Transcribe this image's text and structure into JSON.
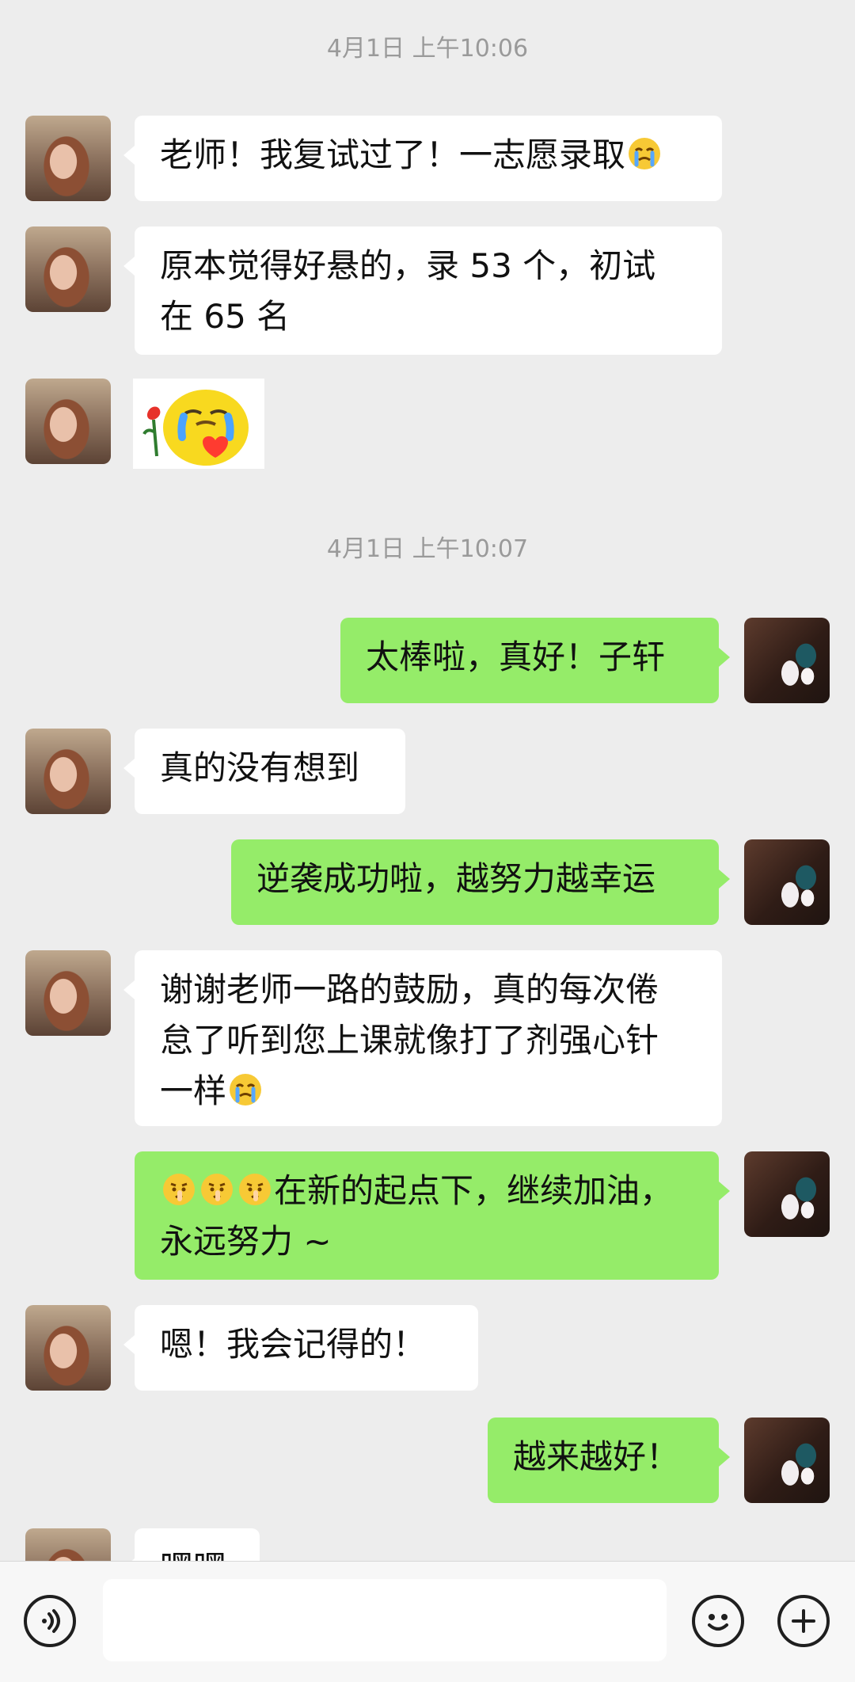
{
  "timestamps": [
    "4月1日 上午10:06",
    "4月1日 上午10:07"
  ],
  "messages": {
    "m1": {
      "text": "老师！我复试过了！一志愿录取",
      "emoji_after": "crying-face-emoji"
    },
    "m2": {
      "line1": "原本觉得好悬的，录 53 个，初试",
      "line2": "在 65 名"
    },
    "m3": {
      "sticker": "crying-duck-with-rose-and-heart-sticker"
    },
    "m4": {
      "text": "太棒啦，真好！子轩"
    },
    "m5": {
      "text": "真的没有想到"
    },
    "m6": {
      "text": "逆袭成功啦，越努力越幸运"
    },
    "m7": {
      "line1": "谢谢老师一路的鼓励，真的每次倦",
      "line2": "怠了听到您上课就像打了剂强心针",
      "line3": "一样",
      "emoji_after": "crying-face-emoji"
    },
    "m8": {
      "emojis": [
        "shushing-face-emoji",
        "shushing-face-emoji",
        "shushing-face-emoji"
      ],
      "line1_text": "在新的起点下，继续加油，",
      "line2": "永远努力 ~"
    },
    "m9": {
      "text": "嗯！我会记得的！"
    },
    "m10": {
      "text": "越来越好！"
    },
    "m11": {
      "text": "嘿嘿"
    }
  },
  "bottom_bar": {
    "left_icon": "voice-icon",
    "right_icons": [
      "emoji-icon",
      "plus-icon"
    ]
  },
  "colors": {
    "background": "#ededed",
    "incoming_bubble": "#ffffff",
    "outgoing_bubble": "#95ec69",
    "timestamp_text": "#9a9a9a",
    "message_text": "#111111"
  }
}
